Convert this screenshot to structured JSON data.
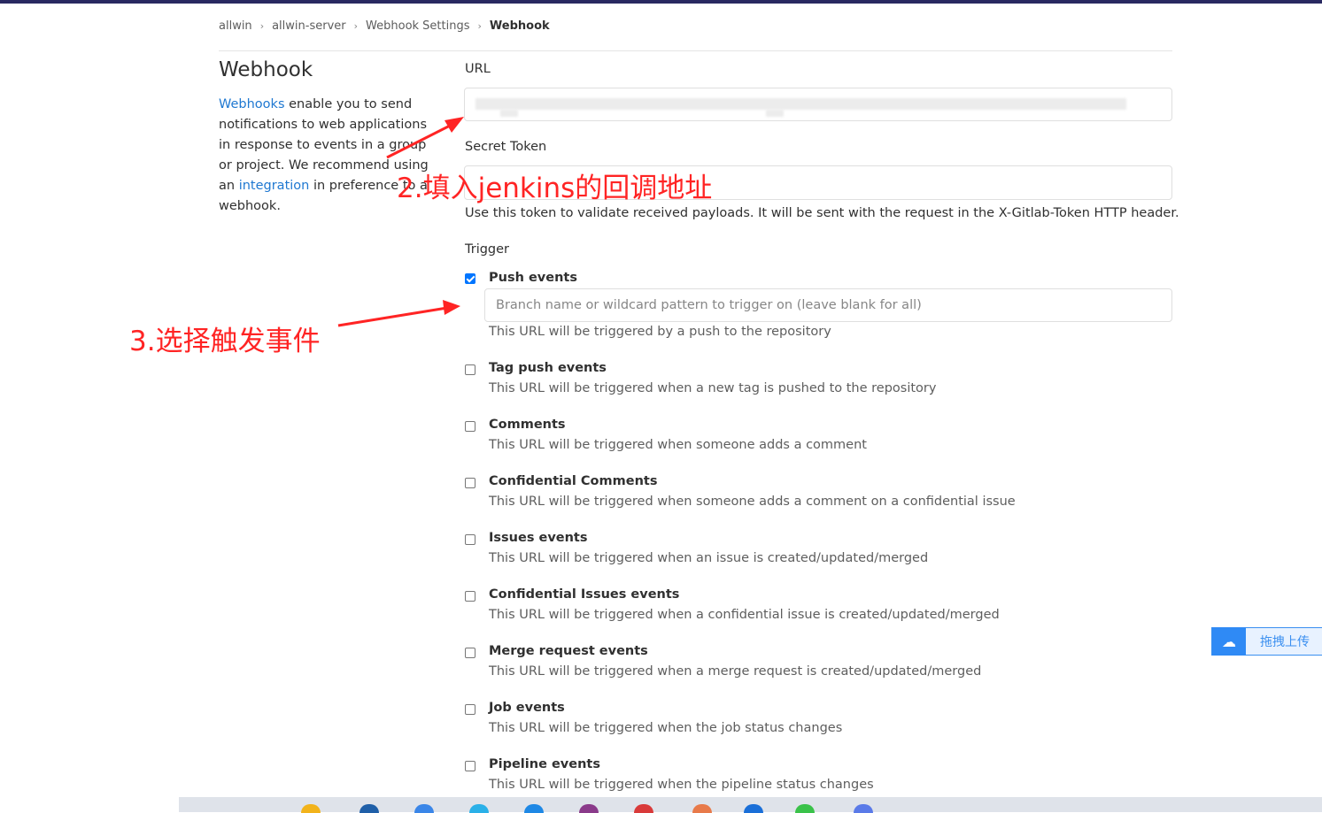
{
  "breadcrumb": [
    "allwin",
    "allwin-server",
    "Webhook Settings",
    "Webhook"
  ],
  "left": {
    "title": "Webhook",
    "desc_link1": "Webhooks",
    "desc_part1": " enable you to send notifications to web applications in response to events in a group or project. We recommend using an ",
    "desc_link2": "integration",
    "desc_part2": " in preference to a webhook."
  },
  "url_label": "URL",
  "secret_label": "Secret Token",
  "secret_help": "Use this token to validate received payloads. It will be sent with the request in the X-Gitlab-Token HTTP header.",
  "trigger_label": "Trigger",
  "branch_placeholder": "Branch name or wildcard pattern to trigger on (leave blank for all)",
  "events": [
    {
      "title": "Push events",
      "help": "This URL will be triggered by a push to the repository",
      "checked": true
    },
    {
      "title": "Tag push events",
      "help": "This URL will be triggered when a new tag is pushed to the repository",
      "checked": false
    },
    {
      "title": "Comments",
      "help": "This URL will be triggered when someone adds a comment",
      "checked": false
    },
    {
      "title": "Confidential Comments",
      "help": "This URL will be triggered when someone adds a comment on a confidential issue",
      "checked": false
    },
    {
      "title": "Issues events",
      "help": "This URL will be triggered when an issue is created/updated/merged",
      "checked": false
    },
    {
      "title": "Confidential Issues events",
      "help": "This URL will be triggered when a confidential issue is created/updated/merged",
      "checked": false
    },
    {
      "title": "Merge request events",
      "help": "This URL will be triggered when a merge request is created/updated/merged",
      "checked": false
    },
    {
      "title": "Job events",
      "help": "This URL will be triggered when the job status changes",
      "checked": false
    },
    {
      "title": "Pipeline events",
      "help": "This URL will be triggered when the pipeline status changes",
      "checked": false
    }
  ],
  "annotations": {
    "step2": "2.填入jenkins的回调地址",
    "step3": "3.选择触发事件"
  },
  "upload_label": "拖拽上传",
  "colors": {
    "link": "#1f78d1",
    "annotation": "#ff2424",
    "topbar": "#292961",
    "checkbox": "#0075ff"
  }
}
